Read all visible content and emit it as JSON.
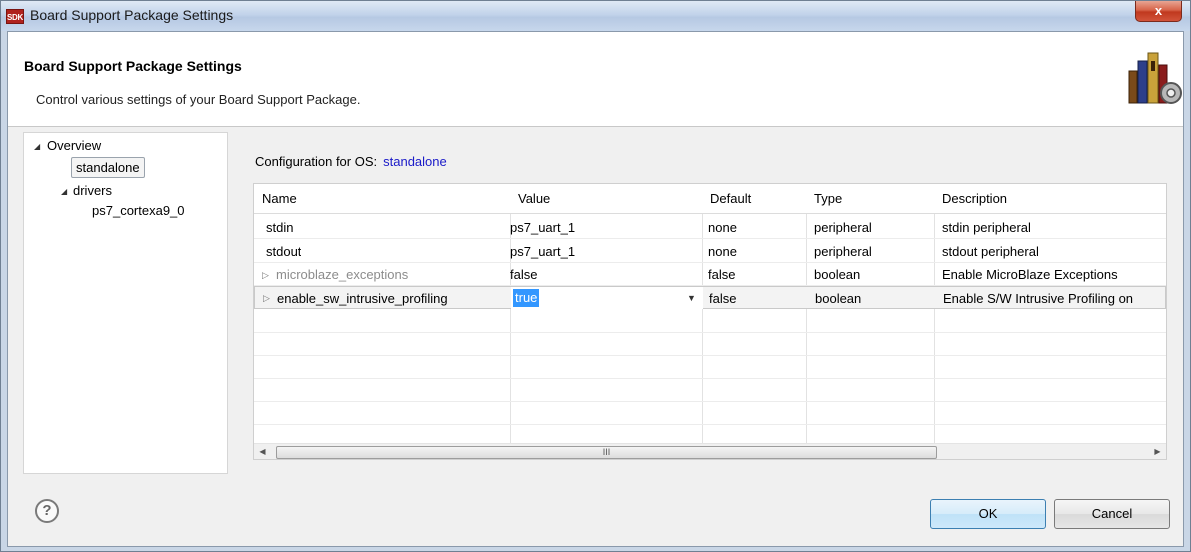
{
  "window": {
    "title": "Board Support Package Settings",
    "app_icon_text": "SDK",
    "close_label": "x"
  },
  "header": {
    "title": "Board Support Package Settings",
    "subtitle": "Control various settings of your Board Support Package."
  },
  "tree": {
    "overview": "Overview",
    "standalone": "standalone",
    "drivers": "drivers",
    "cpu": "ps7_cortexa9_0"
  },
  "config": {
    "label": "Configuration for OS:",
    "os": "standalone"
  },
  "table": {
    "columns": [
      "Name",
      "Value",
      "Default",
      "Type",
      "Description"
    ],
    "rows": [
      {
        "name": "stdin",
        "value": "ps7_uart_1",
        "default": "none",
        "type": "peripheral",
        "description": "stdin peripheral"
      },
      {
        "name": "stdout",
        "value": "ps7_uart_1",
        "default": "none",
        "type": "peripheral",
        "description": "stdout peripheral"
      },
      {
        "name": "microblaze_exceptions",
        "value": "false",
        "default": "false",
        "type": "boolean",
        "description": "Enable MicroBlaze Exceptions"
      },
      {
        "name": "enable_sw_intrusive_profiling",
        "value": "true",
        "default": "false",
        "type": "boolean",
        "description": "Enable S/W Intrusive Profiling on"
      }
    ]
  },
  "scrollbar": {
    "grip": "III"
  },
  "footer": {
    "help": "?",
    "ok": "OK",
    "cancel": "Cancel"
  },
  "colors": {
    "os_link": "#1a1ac8",
    "selection": "#3397ff"
  }
}
